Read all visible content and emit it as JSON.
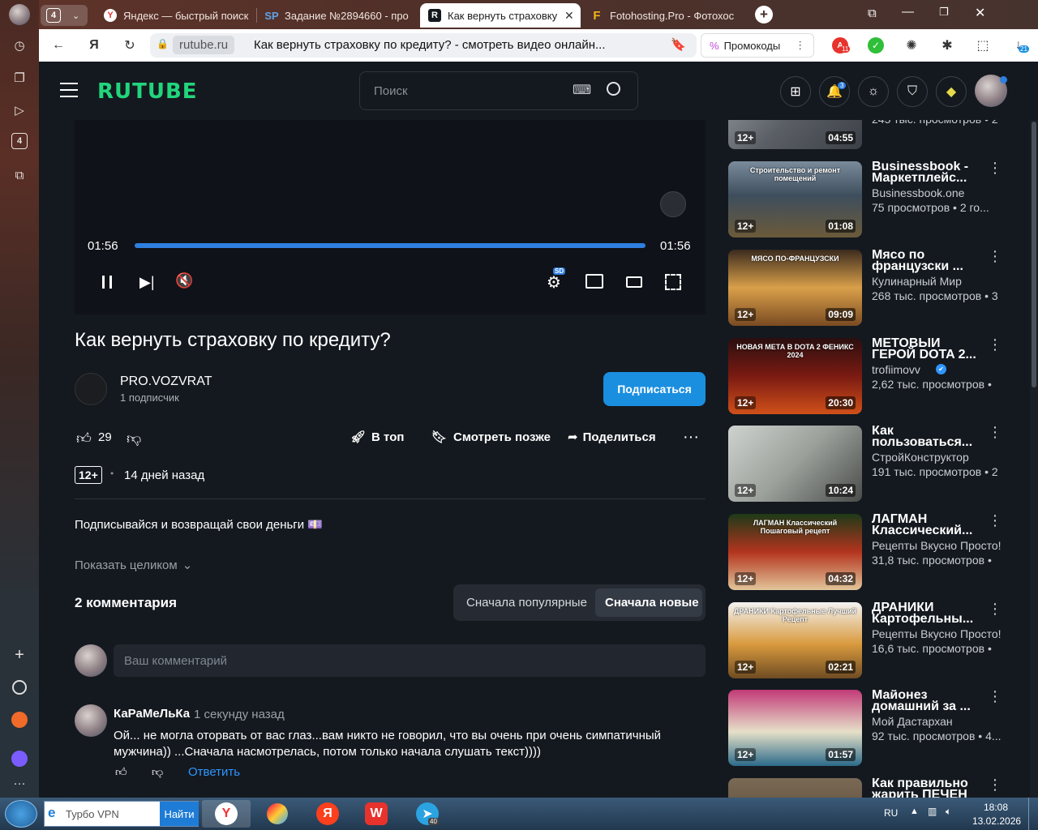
{
  "browser": {
    "tab_count": "4",
    "tabs": [
      {
        "title": "Яндекс — быстрый поиск",
        "icon": "yandex-icon"
      },
      {
        "title": "Задание №2894660 - про",
        "icon": "sp-icon"
      },
      {
        "title": "Как вернуть страховку",
        "icon": "rutube-icon"
      },
      {
        "title": "Fotohosting.Pro - Фотохос",
        "icon": "fotohosting-icon"
      }
    ],
    "domain": "rutube.ru",
    "page_title": "Как вернуть страховку по кредиту? - смотреть видео онлайн...",
    "promo_label": "Промокоды",
    "ext_badge_1": "11",
    "downloads_badge": "21"
  },
  "header": {
    "logo": "RUTUBE",
    "search_placeholder": "Поиск",
    "notif_badge": "3"
  },
  "player": {
    "time_current": "01:56",
    "time_total": "01:56",
    "progress": 1.0,
    "quality_badge": "SD"
  },
  "video": {
    "title": "Как вернуть страховку по кредиту?",
    "channel": "PRO.VOZVRAT",
    "subscribers": "1 подписчик",
    "subscribe_label": "Подписаться",
    "likes": "29",
    "top_label": "В топ",
    "watch_later_label": "Смотреть позже",
    "share_label": "Поделиться",
    "age": "12+",
    "published": "14 дней назад",
    "description": "Подписывайся и возвращай свои деньги 💷",
    "show_more": "Показать целиком"
  },
  "comments": {
    "count_label": "2 комментария",
    "sort_popular": "Сначала популярные",
    "sort_new": "Сначала новые",
    "input_placeholder": "Ваш комментарий",
    "items": [
      {
        "author": "КаРаМеЛьКа",
        "time": "1 секунду назад",
        "line1": "Ой... не могла оторвать от вас глаз...вам никто не говорил, что вы очень  при очень симпатичный",
        "line2": "мужчина)) ...Сначала насмотрелась, потом только начала слушать текст))))",
        "reply": "Ответить"
      }
    ]
  },
  "recommended": [
    {
      "title": "",
      "channel": "",
      "views": "245 тыс. просмотров • 2",
      "age": "12+",
      "duration": "04:55"
    },
    {
      "title": "Businessbook - Маркетплейс...",
      "channel": "Businessbook.one",
      "views": "75 просмотров • 2 го...",
      "age": "12+",
      "duration": "01:08",
      "thumb_caption": "Строительство и ремонт помещений"
    },
    {
      "title": "Мясо по французски ...",
      "channel": "Кулинарный Мир",
      "views": "268 тыс. просмотров • 3",
      "age": "12+",
      "duration": "09:09",
      "thumb_caption": "МЯСО ПО-ФРАНЦУЗСКИ"
    },
    {
      "title": "МЕТОВЫЙ ГЕРОЙ DOTA 2...",
      "channel": "trofiimovv",
      "views": "2,62 тыс. просмотров • ",
      "age": "12+",
      "duration": "20:30",
      "thumb_caption": "НОВАЯ МЕТА В DOTA 2 ФЕНИКС 2024"
    },
    {
      "title": "Как пользоваться...",
      "channel": "СтройКонструктор",
      "views": "191 тыс. просмотров • 2",
      "age": "12+",
      "duration": "10:24"
    },
    {
      "title": "ЛАГМАН Классический...",
      "channel": "Рецепты Вкусно Просто!",
      "views": "31,8 тыс. просмотров • ",
      "age": "12+",
      "duration": "04:32",
      "thumb_caption": "ЛАГМАН Классический Пошаговый рецепт"
    },
    {
      "title": "ДРАНИКИ Картофельны...",
      "channel": "Рецепты Вкусно Просто!",
      "views": "16,6 тыс. просмотров • ",
      "age": "12+",
      "duration": "02:21",
      "thumb_caption": "ДРАНИКИ Картофельные Лучший Рецепт"
    },
    {
      "title": "Майонез домашний за ...",
      "channel": "Мой Дастархан",
      "views": "92 тыс. просмотров • 4...",
      "age": "12+",
      "duration": "01:57"
    },
    {
      "title": "Как правильно жарить ПЕЧЕН",
      "channel": "",
      "views": "",
      "age": "",
      "duration": ""
    }
  ],
  "taskbar": {
    "search_text": "Турбо VPN",
    "search_button": "Найти",
    "lang": "RU",
    "time": "18:08",
    "date": "13.02.2026",
    "telegram_badge": "40"
  },
  "colors": {
    "accent": "#1a8fe0",
    "logo": "#21d57c",
    "bg": "#14191f"
  }
}
